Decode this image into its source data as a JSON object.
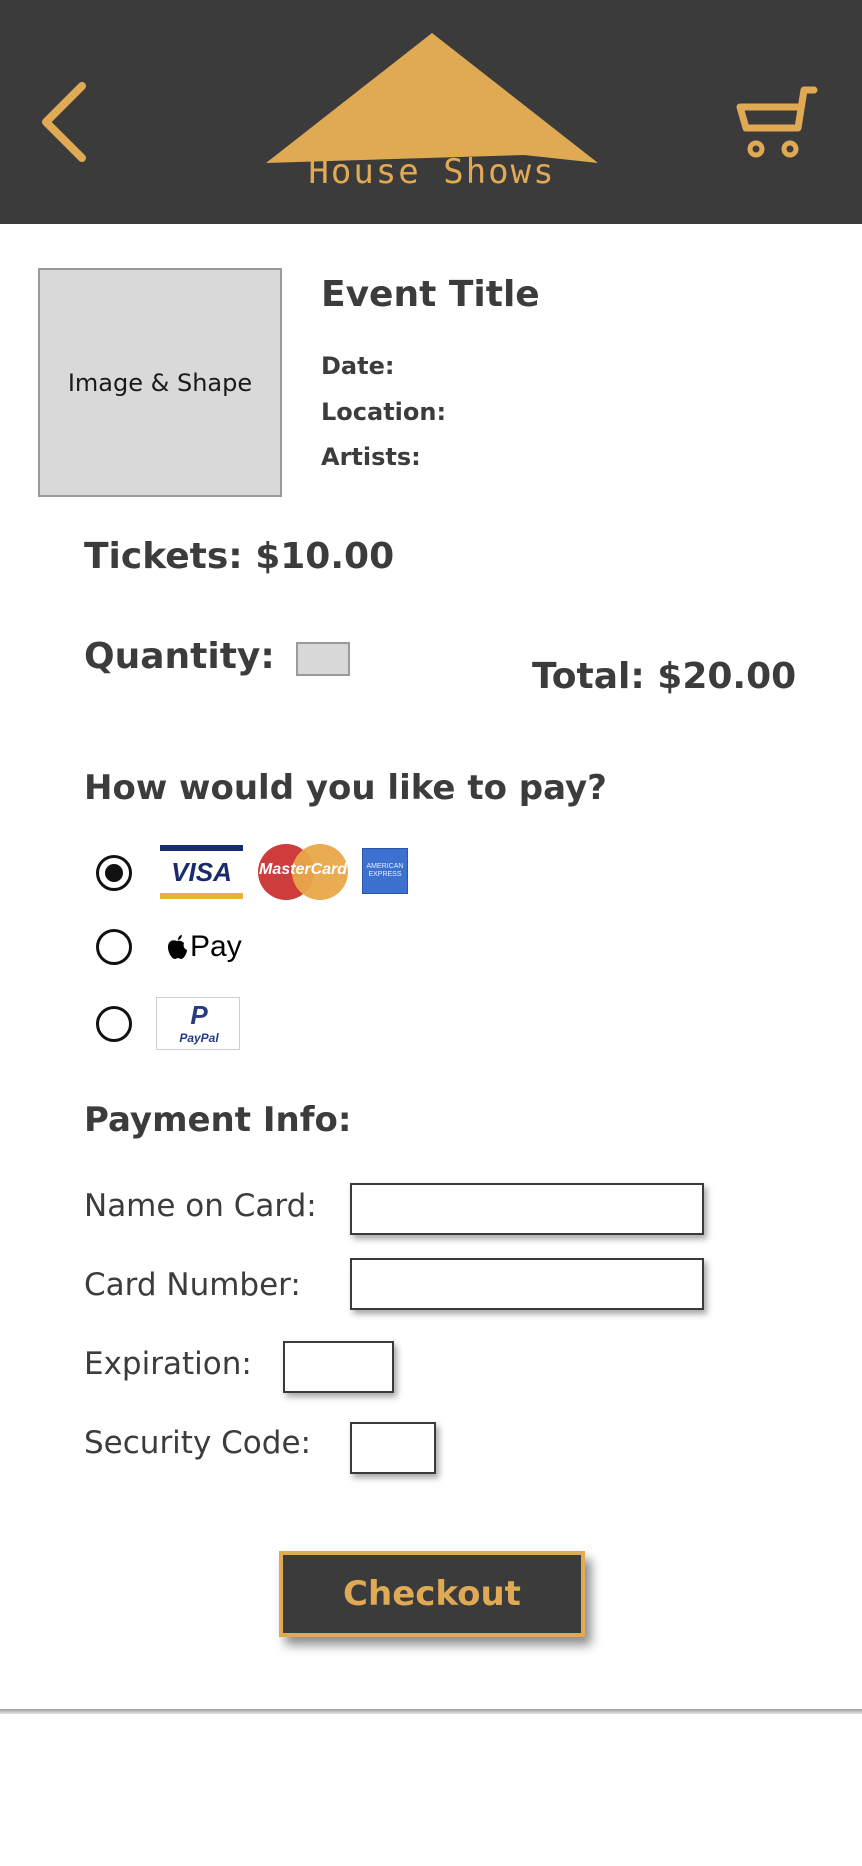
{
  "header": {
    "logo_text": "House Shows",
    "back_icon": "chevron-left-icon",
    "cart_icon": "cart-icon",
    "accent_color": "#e0aa55",
    "background_color": "#3b3b3c"
  },
  "event": {
    "image_placeholder": "Image & Shape",
    "title": "Event Title",
    "date_label": "Date:",
    "location_label": "Location:",
    "artists_label": "Artists:"
  },
  "order": {
    "tickets": "Tickets: $10.00",
    "quantity_label": "Quantity:",
    "quantity_value": "",
    "total": "Total: $20.00"
  },
  "payment": {
    "question": "How would you like to pay?",
    "options": [
      {
        "name": "card",
        "checked": true,
        "logos": [
          "VISA",
          "MasterCard",
          "AMERICAN EXPRESS"
        ]
      },
      {
        "name": "applepay",
        "checked": false,
        "label": "Pay",
        "icon": "apple-icon"
      },
      {
        "name": "paypal",
        "checked": false,
        "label": "PayPal"
      }
    ]
  },
  "payment_info": {
    "heading": "Payment Info:",
    "name_label": "Name on Card:",
    "name_value": "",
    "card_number_label": "Card Number:",
    "card_number_value": "",
    "expiration_label": "Expiration:",
    "expiration_value": "",
    "security_label": "Security Code:",
    "security_value": ""
  },
  "checkout_label": "Checkout"
}
